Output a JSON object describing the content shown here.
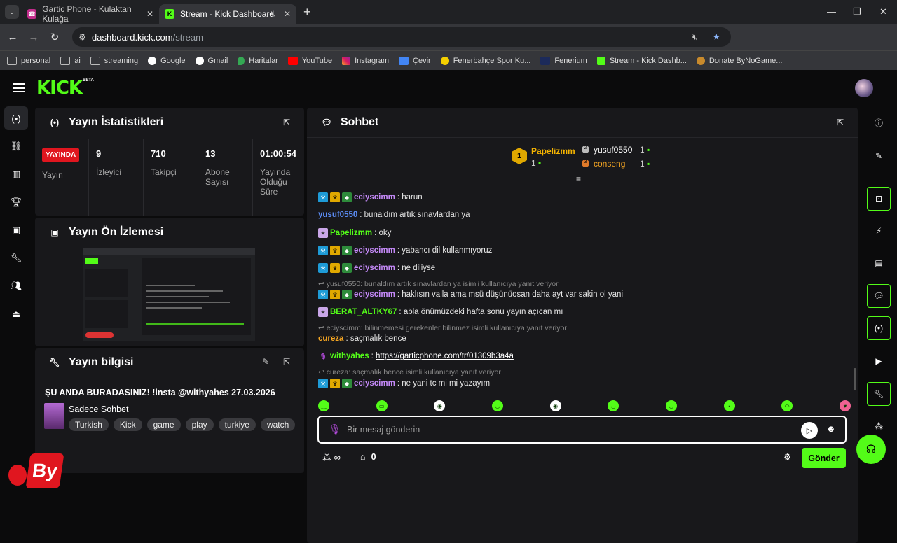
{
  "browser": {
    "tabs": [
      {
        "title": "Gartic Phone - Kulaktan Kulağa",
        "active": false
      },
      {
        "title": "Stream - Kick Dashboard",
        "active": true
      }
    ],
    "url_host": "dashboard.kick.com",
    "url_path": "/stream",
    "bookmarks": [
      "personal",
      "ai",
      "streaming",
      "Google",
      "Gmail",
      "Haritalar",
      "YouTube",
      "Instagram",
      "Çevir",
      "Fenerbahçe Spor Ku...",
      "Fenerium",
      "Stream - Kick Dashb...",
      "Donate ByNoGame..."
    ]
  },
  "app": {
    "logo": "KICK",
    "logo_badge": "BETA",
    "accent": "#53fc18"
  },
  "stats_panel": {
    "title": "Yayın İstatistikleri",
    "live_badge": "YAYINDA",
    "live_label": "Yayın",
    "viewers_value": "9",
    "viewers_label": "İzleyici",
    "followers_value": "710",
    "followers_label": "Takipçi",
    "subs_value": "13",
    "subs_label": "Abone Sayısı",
    "uptime_value": "01:00:54",
    "uptime_label": "Yayında Olduğu Süre"
  },
  "preview_panel": {
    "title": "Yayın Ön İzlemesi"
  },
  "info_panel": {
    "title": "Yayın bilgisi",
    "stream_title": "ŞU ANDA BURADASINIZ! !insta @withyahes 27.03.2026",
    "category": "Sadece Sohbet",
    "tags": [
      "Turkish",
      "Kick",
      "game",
      "play",
      "turkiye",
      "watch"
    ]
  },
  "chat": {
    "title": "Sohbet",
    "leaderboard": {
      "first_name": "Papelizmm",
      "first_count": "1",
      "second_name": "yusuf0550",
      "second_count": "1",
      "third_name": "conseng",
      "third_count": "1"
    },
    "messages": [
      {
        "user": "eciyscimm",
        "text": "harun",
        "color": "#c58af9"
      },
      {
        "user": "yusuf0550",
        "text": "bunaldım artık sınavlardan ya",
        "color": "#5c8df6"
      },
      {
        "user": "Papelizmm",
        "text": "oky",
        "color": "#53fc18"
      },
      {
        "user": "eciyscimm",
        "text": "yabancı dil kullanmıyoruz",
        "color": "#c58af9"
      },
      {
        "user": "eciyscimm",
        "text": "ne diliyse",
        "color": "#c58af9"
      },
      {
        "user": "eciyscimm",
        "text": "haklısın valla ama msü düşünüosan daha ayt var sakin ol yani",
        "color": "#c58af9",
        "reply": "yusuf0550: bunaldım artık sınavlardan ya isimli kullanıcıya yanıt veriyor"
      },
      {
        "user": "BERAT_ALTKY67",
        "text": "abla önümüzdeki hafta sonu yayın açıcan mı",
        "color": "#53fc18"
      },
      {
        "user": "cureza",
        "text": "saçmalık bence",
        "color": "#f5a623",
        "reply": "eciyscimm: bilinmemesi gerekenler bilinmez isimli kullanıcıya yanıt veriyor"
      },
      {
        "user": "withyahes",
        "text": "https://garticphone.com/tr/01309b3a4a",
        "color": "#53fc18"
      },
      {
        "user": "eciyscimm",
        "text": "ne yani tc mi mi yazayım",
        "color": "#c58af9",
        "reply": "cureza: saçmalık bence isimli kullanıcıya yanıt veriyor"
      }
    ],
    "input_placeholder": "Bir mesaj gönderin",
    "points": "0",
    "send_label": "Gönder"
  },
  "watermark": "By"
}
